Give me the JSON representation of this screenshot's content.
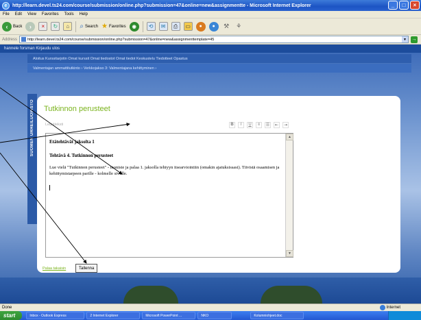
{
  "window": {
    "title": "http://learn.devel.ts24.com/course/submission/online.php?submission=47&online=new&assignmentte - Microsoft Internet Explorer",
    "ie_icon_glyph": "e",
    "minimize_glyph": "_",
    "maximize_glyph": "□",
    "close_glyph": "×"
  },
  "menu": [
    "File",
    "Edit",
    "View",
    "Favorites",
    "Tools",
    "Help"
  ],
  "toolbar": {
    "back_label": "Back",
    "search_label": "Search",
    "favorites_label": "Favorites"
  },
  "address": {
    "label": "Address",
    "url": "http://learn.devel.ts24.com/course/submission/online.php?submission=47&online=new&assignmenttemplate=45",
    "go_glyph": "→"
  },
  "page": {
    "userbar": "hannele forsman  Kirjaudu ulos",
    "nav_primary": "Aloitus  Kurssitarjotin  Omat kurssit  Omat tiedostot  Omat tiedot  Keskustelu  Tiedotteet  Opastus",
    "nav_breadcrumb": "Valmentajan ammattitutkinto  ›  Verkkojakso 3: Valmentajana kehittyminen  ›",
    "sidebar_label": "SUOMEN URHEILUOPISTO",
    "card_title": "Tutkinnon perusteet",
    "rte_placeholder": "Leipäteksti"
  },
  "editor": {
    "heading1": "Etätehtävät jaksolta 1",
    "heading2": "Tehtävä 4. Tutkinnon perusteet",
    "paragraph": "Lue vielä \"Tutkinnon perusteet\" - moniste ja palaa 1. jaksolla tehtyyn itsearviointiin (omakin ajatuksissasi). Tiivistä osaamisen ja kehittymistarpeen parille - kolmelle sivulle."
  },
  "actions": {
    "back_link": "Palaa takaisin",
    "save_button": "Tallenna"
  },
  "status": {
    "left": "Done",
    "zone": "Internet"
  },
  "taskbar": {
    "start": "start",
    "tasks": [
      "Inbox - Outlook Express",
      "2 Internet Explorer",
      "Microsoft PowerPoint ...",
      "NKO",
      "Kolumniohjeet.doc"
    ]
  }
}
